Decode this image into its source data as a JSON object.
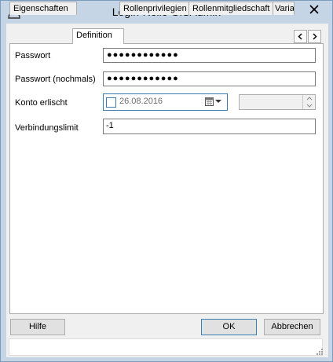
{
  "window": {
    "title": "Login-Rolle GISAdmin",
    "close_label": "X"
  },
  "tabs": [
    {
      "label": "Eigenschaften"
    },
    {
      "label": "Definition"
    },
    {
      "label": "Rollenprivilegien"
    },
    {
      "label": "Rollenmitgliedschaft"
    },
    {
      "label": "Varia"
    }
  ],
  "active_tab": "Definition",
  "tab_scroll": {
    "left": "<",
    "right": ">"
  },
  "form": {
    "password_label": "Passwort",
    "password_value": "●●●●●●●●●●●●",
    "password_repeat_label": "Passwort (nochmals)",
    "password_repeat_value": "●●●●●●●●●●●●",
    "expires_label": "Konto erlischt",
    "expires_date": "26.08.2016",
    "expires_checked": false,
    "limit_label": "Verbindungslimit",
    "limit_value": "-1"
  },
  "buttons": {
    "help": "Hilfe",
    "ok": "OK",
    "cancel": "Abbrechen"
  },
  "status_text": "",
  "colors": {
    "titlebar": "#c6d5e6",
    "focus_border": "#3d7bad",
    "button_bg": "#e1e1e1"
  }
}
